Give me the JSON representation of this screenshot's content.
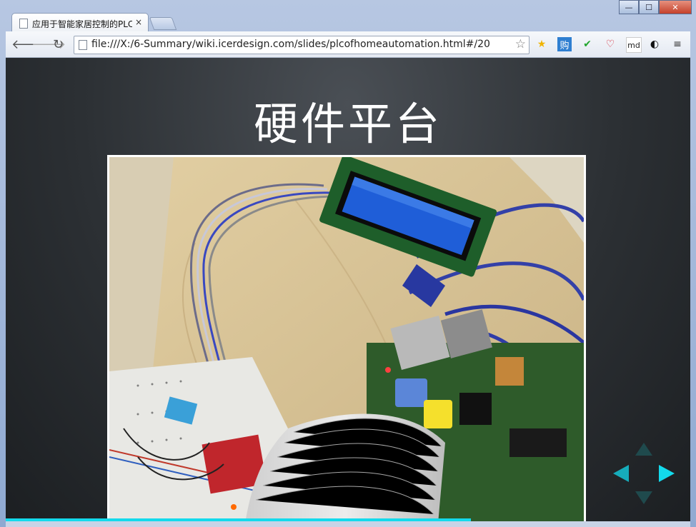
{
  "browser": {
    "tab_title": "应用于智能家居控制的PLC",
    "tab_close": "×",
    "url": "file:///X:/6-Summary/wiki.icerdesign.com/slides/plcofhomeautomation.html#/20",
    "window_buttons": {
      "minimize": "—",
      "maximize": "☐",
      "close": "✕"
    },
    "extensions": [
      {
        "name": "bookmark-star-icon",
        "glyph": "★",
        "color": "#f0b400"
      },
      {
        "name": "gou-extension-icon",
        "glyph": "购",
        "color": "#2f7fd1"
      },
      {
        "name": "check-extension-icon",
        "glyph": "✔",
        "color": "#22a52e"
      },
      {
        "name": "heart-extension-icon",
        "glyph": "♡",
        "color": "#d2202f"
      },
      {
        "name": "md-extension-icon",
        "glyph": "md",
        "color": "#222222"
      },
      {
        "name": "contrast-extension-icon",
        "glyph": "◐",
        "color": "#111111"
      },
      {
        "name": "menu-icon",
        "glyph": "≡",
        "color": "#333333"
      }
    ]
  },
  "slide": {
    "title": "硬件平台",
    "progress_fraction": 0.68,
    "accent_color": "#13daec"
  }
}
